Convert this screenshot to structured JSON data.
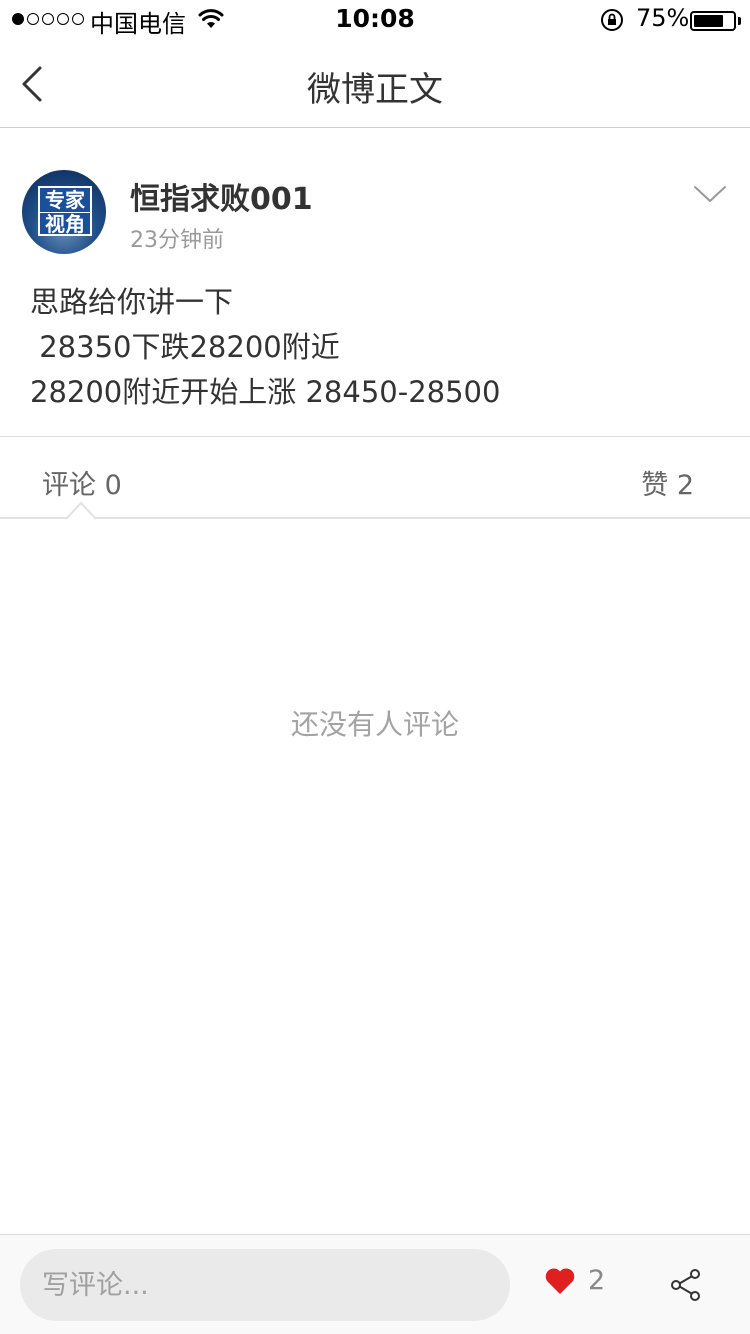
{
  "status_bar": {
    "carrier": "中国电信",
    "time": "10:08",
    "battery_percent_text": "75%",
    "battery_level": 0.75,
    "signal_bars_filled": 1,
    "signal_bars_total": 5
  },
  "nav": {
    "title": "微博正文",
    "back_icon": "chevron-left-icon"
  },
  "post": {
    "avatar_line1": "专家",
    "avatar_line2": "视角",
    "user_name": "恒指求败001",
    "time_ago": "23分钟前",
    "text": "思路给你讲一下\n 28350下跌28200附近\n28200附近开始上涨 28450-28500"
  },
  "tabs": {
    "comments": "评论 0",
    "likes": "赞 2"
  },
  "empty_state": "还没有人评论",
  "bottom_bar": {
    "comment_placeholder": "写评论...",
    "like_count": "2",
    "like_color": "#e02020"
  }
}
